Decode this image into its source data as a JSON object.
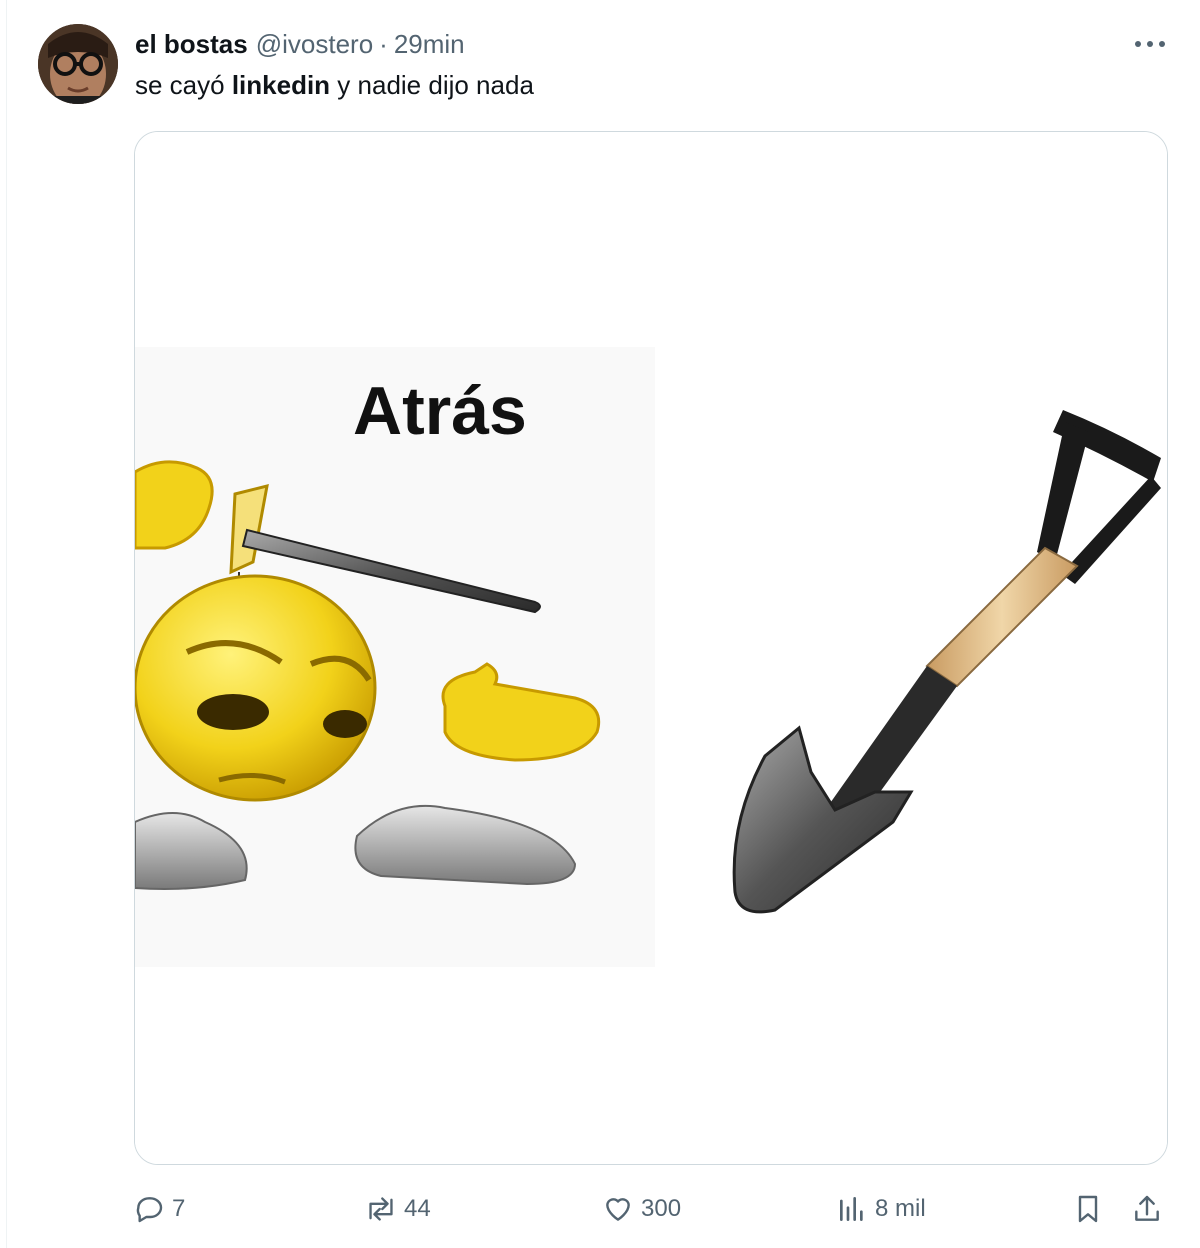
{
  "tweet": {
    "author_name": "el bostas",
    "author_handle": "@ivostero",
    "separator": "·",
    "time": "29min",
    "text_before": "se cayó ",
    "text_bold": "linkedin",
    "text_after": " y nadie dijo nada"
  },
  "media": {
    "caption": "Atrás"
  },
  "actions": {
    "replies": "7",
    "reposts": "44",
    "likes": "300",
    "views": "8 mil"
  },
  "icons": {
    "more": "more-horizontal-icon",
    "reply": "reply-icon",
    "repost": "repost-icon",
    "like": "heart-icon",
    "views": "bar-chart-icon",
    "bookmark": "bookmark-icon",
    "share": "share-icon"
  },
  "colors": {
    "text": "#0f1419",
    "secondary": "#536471",
    "border": "#cfd9de"
  }
}
